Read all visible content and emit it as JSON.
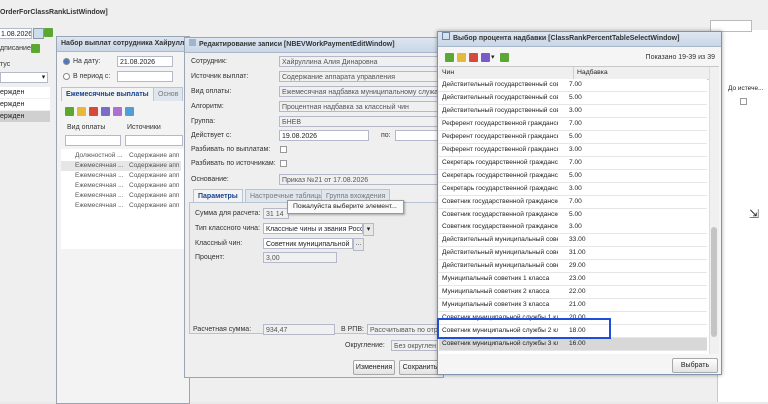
{
  "main": {
    "title": "OrderForClassRankListWindow]",
    "date_value": "1.08.2026",
    "add_label": "дписание",
    "status_label": "тус",
    "rows": [
      "ержден",
      "ержден",
      "ержден"
    ]
  },
  "payments_window": {
    "title": "Набор выплат сотрудника Хайрулли",
    "on_date_label": "На дату:",
    "on_date_value": "21.08.2026",
    "period_label": "В период с:",
    "tabs": [
      "Ежемесячные выплаты",
      "Основ"
    ],
    "col_kind": "Вид оплаты",
    "col_source": "Источники",
    "rows": [
      {
        "kind": "Должностной ...",
        "source": "Содержание апп"
      },
      {
        "kind": "Ежемесячная ...",
        "source": "Содержание апп"
      },
      {
        "kind": "Ежемесячная ...",
        "source": "Содержание апп"
      },
      {
        "kind": "Ежемесячная ...",
        "source": "Содержание апп"
      },
      {
        "kind": "Ежемесячная ...",
        "source": "Содержание апп"
      },
      {
        "kind": "Ежемесячная ...",
        "source": "Содержание апп"
      }
    ]
  },
  "edit_window": {
    "title": "Редактирование записи [NBEVWorkPaymentEditWindow]",
    "employee_label": "Сотрудник:",
    "employee_value": "Хайруллина Алия Динаровна",
    "source_label": "Источник выплат:",
    "source_value": "Содержание аппарата управления",
    "kind_label": "Вид оплаты:",
    "kind_value": "Ежемесячная надбавка муниципальному служащ",
    "algorithm_label": "Алгоритм:",
    "algorithm_value": "Процентная надбавка за классный чин",
    "group_label": "Группа:",
    "group_value": "БНЕВ",
    "valid_from_label": "Действует с:",
    "valid_from_value": "19.08.2026",
    "valid_to_label": "по:",
    "split_payments_label": "Разбивать по выплатам:",
    "split_sources_label": "Разбивать по источникам:",
    "basis_label": "Основание:",
    "basis_value": "Приказ №21 от 17.08.2026",
    "tabs": [
      "Параметры",
      "Настроечные таблицы",
      "Группа вхождения"
    ],
    "sum_label": "Сумма для расчета:",
    "sum_value": "31 14",
    "chin_type_label": "Тип классного чина:",
    "chin_type_value": "Классные чины и звания Росс",
    "chin_label": "Классный чин:",
    "chin_value": "Советник муниципальной",
    "percent_label": "Процент:",
    "percent_value": "3,00",
    "tooltip": "Пожалуйста выберите элемент...",
    "calc_sum_label": "Расчетная сумма:",
    "calc_sum_value": "934,47",
    "rpv_label": "В РПВ:",
    "rpv_value": "Рассчитывать по отр",
    "rounding_label": "Округление:",
    "rounding_value": "Без округлен",
    "changes_button": "Изменения",
    "save_button": "Сохранить"
  },
  "select_window": {
    "title": "Выбор процента надбавки [ClassRankPercentTableSelectWindow]",
    "shown": "Показано 19-39 из 39",
    "col_rank": "Чин",
    "col_bonus": "Надбавка",
    "rows": [
      {
        "rank": "Действительный государственный сов...",
        "bonus": "7.00"
      },
      {
        "rank": "Действительный государственный сов...",
        "bonus": "5.00"
      },
      {
        "rank": "Действительный государственный сов...",
        "bonus": "3.00"
      },
      {
        "rank": "Референт государственной гражданск...",
        "bonus": "7.00"
      },
      {
        "rank": "Референт государственной гражданск...",
        "bonus": "5.00"
      },
      {
        "rank": "Референт государственной гражданск...",
        "bonus": "3.00"
      },
      {
        "rank": "Секретарь государственной гражданск...",
        "bonus": "7.00"
      },
      {
        "rank": "Секретарь государственной гражданск...",
        "bonus": "5.00"
      },
      {
        "rank": "Секретарь государственной гражданск...",
        "bonus": "3.00"
      },
      {
        "rank": "Советник государственной гражданско...",
        "bonus": "7.00"
      },
      {
        "rank": "Советник государственной гражданско...",
        "bonus": "5.00"
      },
      {
        "rank": "Советник государственной гражданско...",
        "bonus": "3.00"
      },
      {
        "rank": "Действительный муниципальный совет...",
        "bonus": "33.00"
      },
      {
        "rank": "Действительный муниципальный совет...",
        "bonus": "31.00"
      },
      {
        "rank": "Действительный муниципальный совет...",
        "bonus": "29.00"
      },
      {
        "rank": "Муниципальный советник 1 класса",
        "bonus": "23.00"
      },
      {
        "rank": "Муниципальный советник 2 класса",
        "bonus": "22.00"
      },
      {
        "rank": "Муниципальный советник 3 класса",
        "bonus": "21.00"
      },
      {
        "rank": "Советник муниципальной службы 1 кл...",
        "bonus": "20.00"
      },
      {
        "rank": "Советник муниципальной службы 2 кл...",
        "bonus": "18.00"
      },
      {
        "rank": "Советник муниципальной службы 3 кл...",
        "bonus": "16.00"
      }
    ],
    "select_button": "Выбрать"
  },
  "right_panel": {
    "col_expired": "До истече..."
  },
  "colors": {
    "highlight": "#1f4fd6",
    "title_bg": "#c9d6e6",
    "selected_row": "#d8d8d8"
  }
}
